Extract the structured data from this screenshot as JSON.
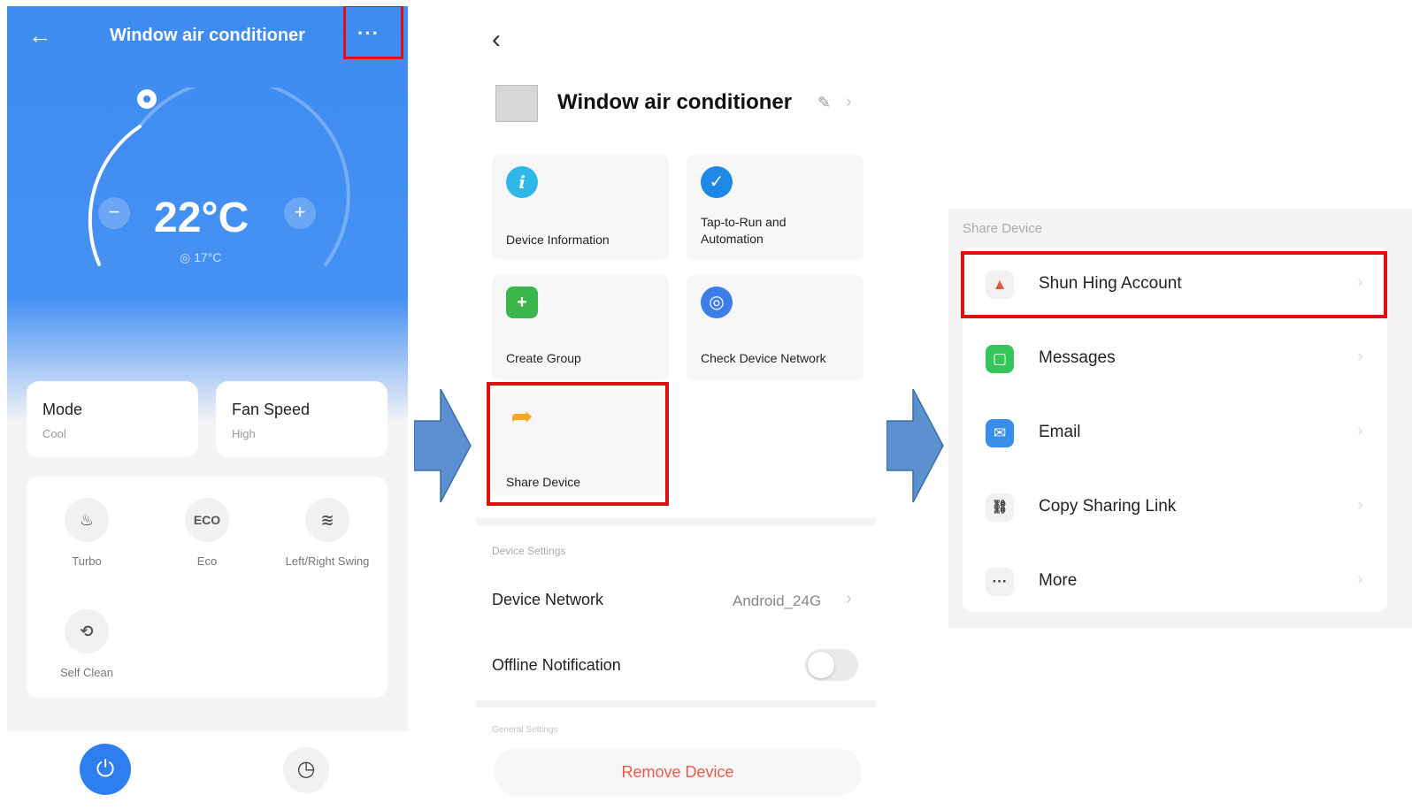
{
  "colors": {
    "highlight": "#e01010",
    "accent": "#3e8bf2",
    "arrow": "#5b8fcf",
    "danger": "#e85a4f"
  },
  "ac_panel": {
    "back_icon": "arrow-left-icon",
    "title": "Window air conditioner",
    "more_icon": "more-dots-icon",
    "more_glyph": "···",
    "temperature": "22°C",
    "minus_glyph": "−",
    "plus_glyph": "+",
    "indoor_temp": "17°C",
    "mode": {
      "title": "Mode",
      "value": "Cool"
    },
    "fan_speed": {
      "title": "Fan Speed",
      "value": "High"
    },
    "functions": [
      {
        "label": "Turbo",
        "icon": "turbo-icon",
        "glyph": "♨"
      },
      {
        "label": "Eco",
        "icon": "eco-icon",
        "glyph": "ECO"
      },
      {
        "label": "Left/Right Swing",
        "icon": "swing-icon",
        "glyph": "≋"
      },
      {
        "label": "Self Clean",
        "icon": "self-clean-icon",
        "glyph": "⟲"
      }
    ],
    "power_icon": "power-icon",
    "power_glyph": "⏻",
    "timer_icon": "timer-icon",
    "timer_glyph": "◷"
  },
  "device_panel": {
    "back_glyph": "‹",
    "device_title": "Window air conditioner",
    "edit_glyph": "✎",
    "edit_chev": "›",
    "tiles": [
      {
        "label": "Device Information",
        "icon": "info-icon",
        "glyph": "i",
        "color": "#2fb7e8"
      },
      {
        "label": "Tap-to-Run and Automation",
        "icon": "check-icon",
        "glyph": "✓",
        "color": "#1e88e5"
      },
      {
        "label": "Create Group",
        "icon": "group-icon",
        "glyph": "+",
        "color": "#3bb54a"
      },
      {
        "label": "Check Device Network",
        "icon": "network-icon",
        "glyph": "◎",
        "color": "#3d7de8"
      },
      {
        "label": "Share Device",
        "icon": "share-icon",
        "glyph": "➦",
        "color": "#f5a623"
      }
    ],
    "settings_section": "Device Settings",
    "device_network": {
      "label": "Device Network",
      "value": "Android_24G",
      "chev": "›"
    },
    "offline_notification": {
      "label": "Offline Notification",
      "enabled": false
    },
    "general_section": "General Settings",
    "remove_button": "Remove Device"
  },
  "share_panel": {
    "title": "Share Device",
    "chev": "›",
    "items": [
      {
        "label": "Shun Hing Account",
        "icon": "shun-hing-logo-icon",
        "glyph": "▲",
        "color": "#e05b3a",
        "bg": "#f2f2f2"
      },
      {
        "label": "Messages",
        "icon": "messages-icon",
        "glyph": "▢",
        "color": "#ffffff",
        "bg": "#35c659"
      },
      {
        "label": "Email",
        "icon": "email-icon",
        "glyph": "✉",
        "color": "#ffffff",
        "bg": "#3b8ee8"
      },
      {
        "label": "Copy Sharing Link",
        "icon": "link-icon",
        "glyph": "⛓",
        "color": "#444444",
        "bg": "#f2f2f2"
      },
      {
        "label": "More",
        "icon": "more-icon",
        "glyph": "···",
        "color": "#444444",
        "bg": "#f2f2f2"
      }
    ]
  }
}
